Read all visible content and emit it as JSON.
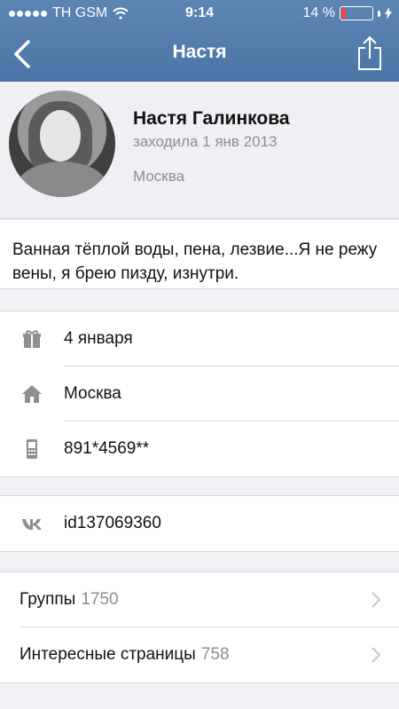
{
  "status_bar": {
    "carrier": "TH GSM",
    "time": "9:14",
    "battery": "14 %",
    "battery_level": 0.14
  },
  "nav": {
    "title": "Настя"
  },
  "profile": {
    "name": "Настя Галинкова",
    "last_seen": "заходила 1 янв 2013",
    "city": "Москва"
  },
  "status_text": "Ванная тёплой воды, пена, лезвие...Я не режу вены, я брею пизду, изнутри.",
  "info": {
    "birthday": "4 января",
    "city": "Москва",
    "phone": "891*4569**"
  },
  "vk_id": "id137069360",
  "links": [
    {
      "label": "Группы",
      "count": "1750"
    },
    {
      "label": "Интересные страницы",
      "count": "758"
    }
  ]
}
